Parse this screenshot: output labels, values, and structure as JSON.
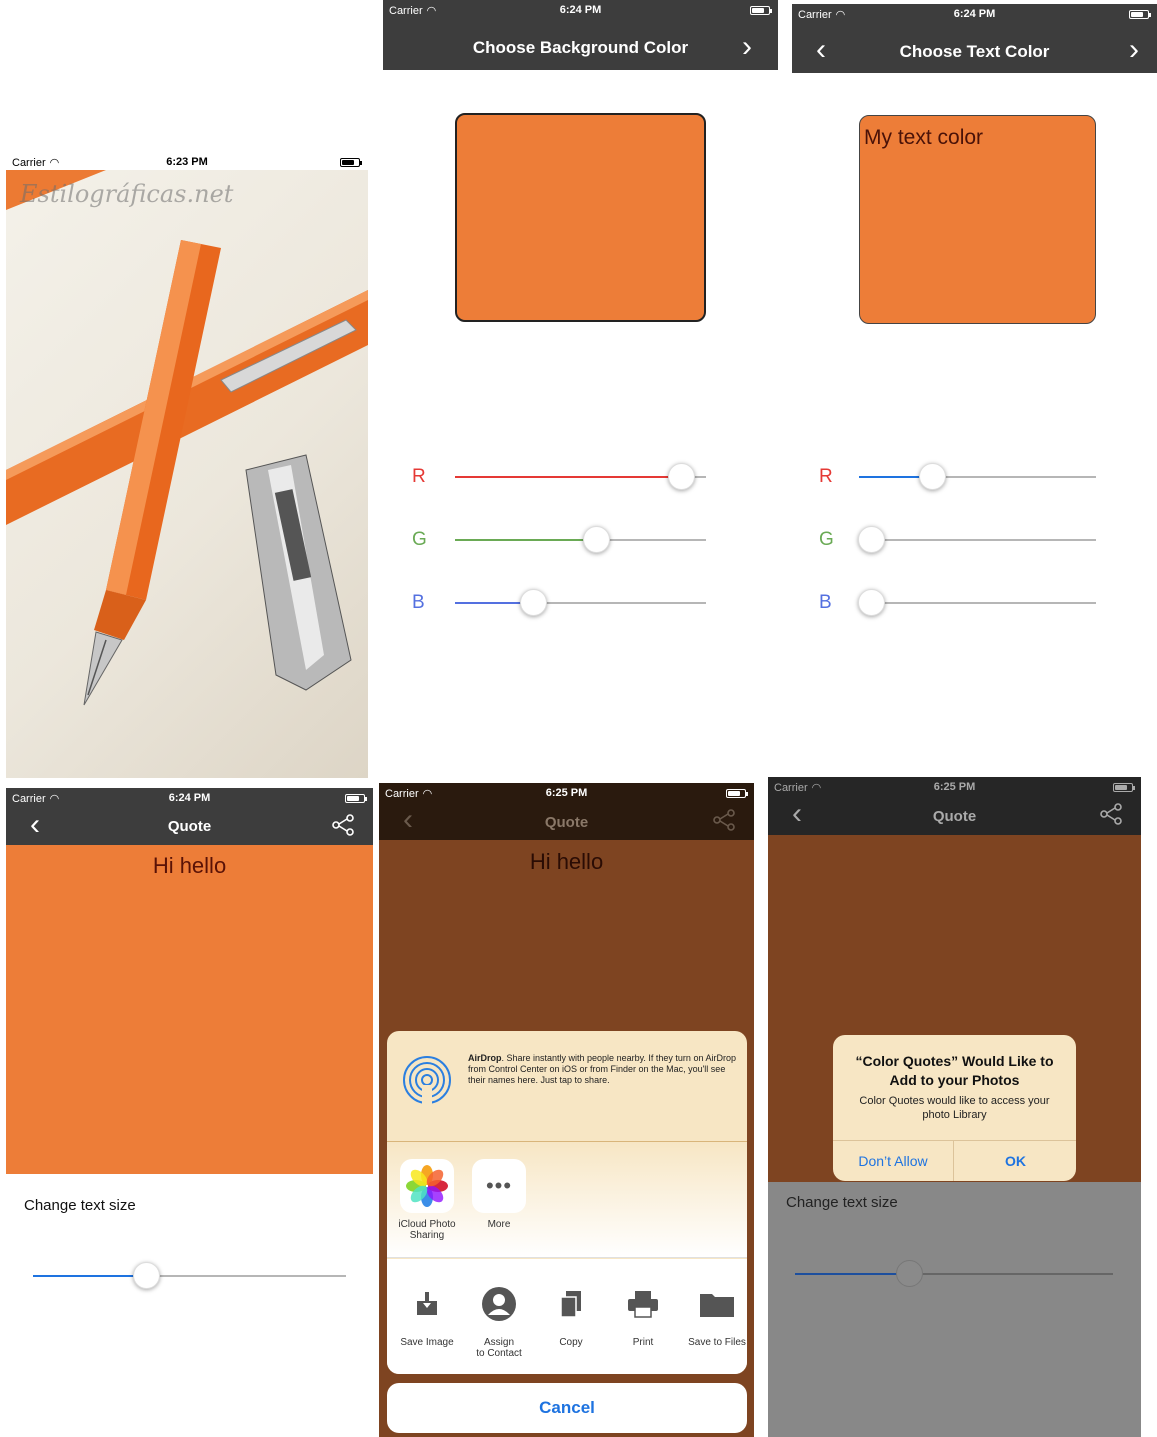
{
  "colors": {
    "navbar": "#3d3d3d",
    "orange": "#ed7d38",
    "dark_orange": "#7e4421",
    "dark_nav": "#2a1a0e",
    "red_track": "#e53935",
    "green_track": "#6aaa55",
    "blue_track": "#5470e0",
    "ios_blue": "#1e73e0"
  },
  "panel1": {
    "status": {
      "carrier": "Carrier",
      "time": "6:23 PM"
    },
    "watermark": "Estilográficas.net",
    "image_subject": "orange fountain pen and chrome cap"
  },
  "panel2": {
    "status": {
      "carrier": "Carrier",
      "time": "6:24 PM"
    },
    "title": "Choose Background Color",
    "sliders": [
      {
        "label": "R",
        "value": 0.9
      },
      {
        "label": "G",
        "value": 0.56
      },
      {
        "label": "B",
        "value": 0.31
      }
    ]
  },
  "panel3": {
    "status": {
      "carrier": "Carrier",
      "time": "6:24 PM"
    },
    "title": "Choose Text Color",
    "preview_text": "My text color",
    "sliders": [
      {
        "label": "R",
        "value": 0.31
      },
      {
        "label": "G",
        "value": 0.05
      },
      {
        "label": "B",
        "value": 0.05
      }
    ]
  },
  "panel4": {
    "status": {
      "carrier": "Carrier",
      "time": "6:24 PM"
    },
    "title": "Quote",
    "quote": "Hi hello",
    "change_text_size": "Change text size",
    "text_size_value": 0.36
  },
  "panel5": {
    "status": {
      "carrier": "Carrier",
      "time": "6:25 PM"
    },
    "title": "Quote",
    "quote": "Hi hello",
    "airdrop_title": "AirDrop",
    "airdrop_text": ". Share instantly with people nearby. If they turn on AirDrop from Control Center on iOS or from Finder on the Mac, you'll see their names here. Just tap to share.",
    "app_row": [
      {
        "line1": "iCloud Photo",
        "line2": "Sharing",
        "icon": "photos-icon"
      },
      {
        "line1": "More",
        "line2": "",
        "icon": "more-icon"
      }
    ],
    "action_row": [
      {
        "line1": "Save Image",
        "line2": "",
        "icon": "save-image-icon"
      },
      {
        "line1": "Assign",
        "line2": "to Contact",
        "icon": "contact-icon"
      },
      {
        "line1": "Copy",
        "line2": "",
        "icon": "copy-icon"
      },
      {
        "line1": "Print",
        "line2": "",
        "icon": "print-icon"
      },
      {
        "line1": "Save to Files",
        "line2": "",
        "icon": "folder-icon"
      }
    ],
    "cancel": "Cancel"
  },
  "panel6": {
    "status": {
      "carrier": "Carrier",
      "time": "6:25 PM"
    },
    "title": "Quote",
    "change_text_size": "Change text size",
    "text_size_value": 0.36,
    "alert": {
      "title": "“Color Quotes” Would Like to Add to your Photos",
      "message": "Color Quotes would like to access your photo Library",
      "deny": "Don’t Allow",
      "ok": "OK"
    }
  }
}
